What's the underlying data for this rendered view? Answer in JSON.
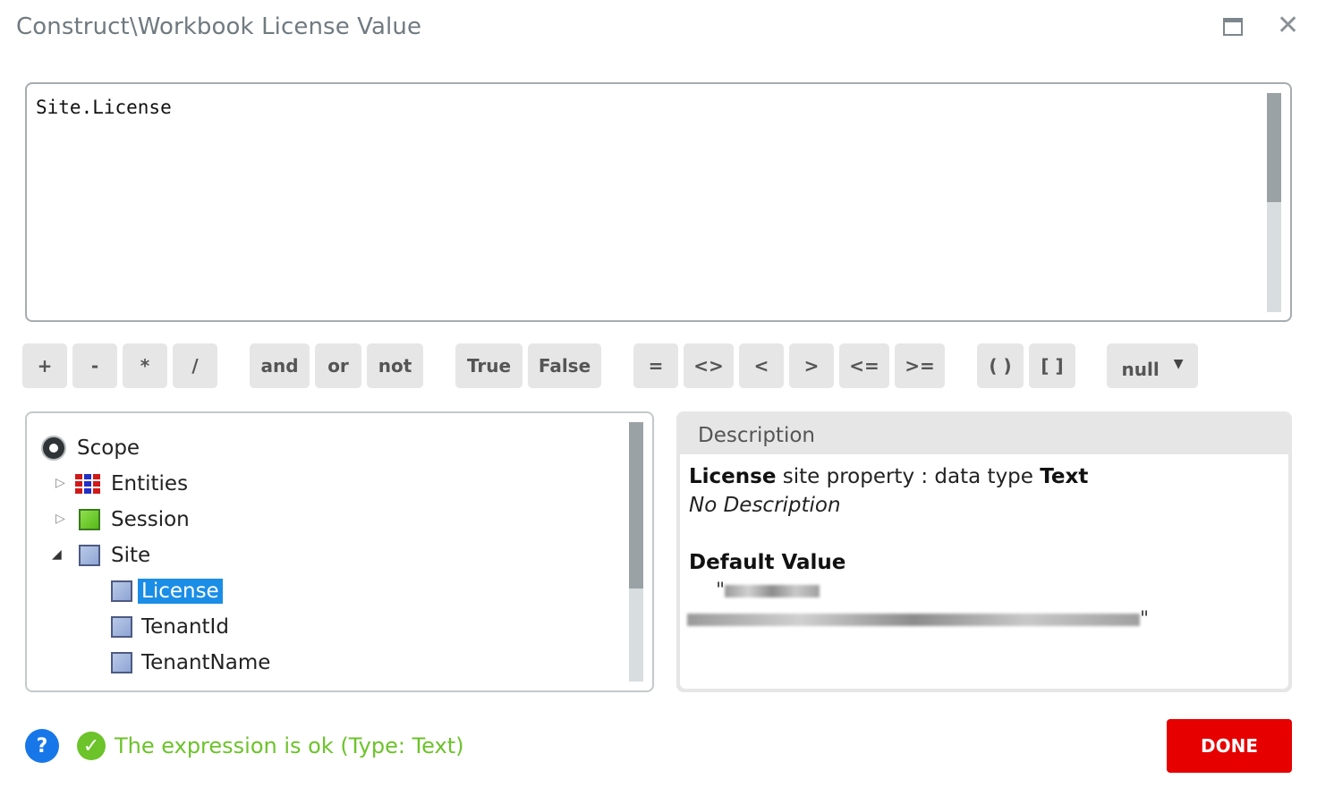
{
  "window": {
    "title": "Construct\\Workbook License Value",
    "maximize_icon": "maximize-icon",
    "close_icon": "close-icon"
  },
  "editor": {
    "expression": "Site.License"
  },
  "operators": [
    "+",
    "-",
    "*",
    "/",
    "and",
    "or",
    "not",
    "True",
    "False",
    "=",
    "<>",
    "<",
    ">",
    "<=",
    ">=",
    "( )",
    "[ ]"
  ],
  "null_dropdown": {
    "label": "null"
  },
  "tree": {
    "root": "Scope",
    "items": [
      "Entities",
      "Session",
      "Site",
      "License",
      "TenantId",
      "TenantName"
    ],
    "selected": "License"
  },
  "description": {
    "header": "Description",
    "name": "License",
    "kind": "site property : data type",
    "data_type": "Text",
    "note": "No Description",
    "default_value_label": "Default Value",
    "quote": "\""
  },
  "footer": {
    "status": "The expression is ok (Type: Text)",
    "status_color": "#6cc32a",
    "done_label": "DONE",
    "help_label": "?"
  },
  "colors": {
    "accent_red": "#e60000",
    "selection_blue": "#1a8de6",
    "help_blue": "#1877e8"
  }
}
